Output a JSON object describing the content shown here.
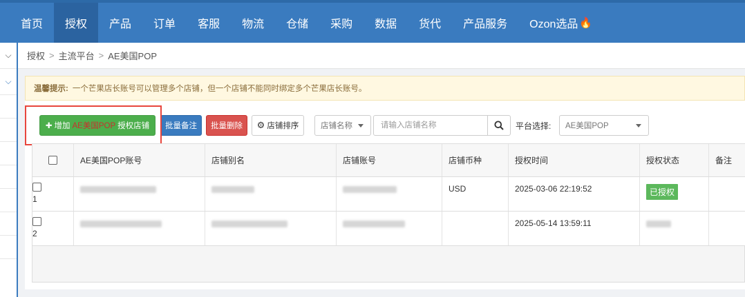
{
  "nav": {
    "items": [
      "首页",
      "授权",
      "产品",
      "订单",
      "客服",
      "物流",
      "仓储",
      "采购",
      "数据",
      "货代",
      "产品服务",
      "Ozon选品"
    ],
    "active": "授权"
  },
  "breadcrumb": [
    "授权",
    "主流平台",
    "AE美国POP"
  ],
  "tip": {
    "label": "温馨提示:",
    "text": "一个芒果店长账号可以管理多个店铺，但一个店铺不能同时绑定多个芒果店长账号。"
  },
  "toolbar": {
    "add_prefix": "增加",
    "add_platform": "AE美国POP",
    "add_suffix": "授权店铺",
    "batch_note": "批量备注",
    "batch_delete": "批量删除",
    "shop_sort": "店铺排序",
    "search_field_select": "店铺名称",
    "search_placeholder": "请输入店铺名称",
    "platform_label": "平台选择:",
    "platform_value": "AE美国POP"
  },
  "table": {
    "headers": [
      "AE美国POP账号",
      "店铺别名",
      "店铺账号",
      "店铺币种",
      "授权时间",
      "授权状态",
      "备注"
    ],
    "rows": [
      {
        "index": "1",
        "currency": "USD",
        "auth_time": "2025-03-06 22:19:52",
        "status": "已授权"
      },
      {
        "index": "2",
        "currency": "",
        "auth_time": "2025-05-14 13:59:11",
        "status": ""
      }
    ]
  },
  "colors": {
    "nav_bg": "#3a7bbf",
    "nav_active": "#2b63a0",
    "add_btn": "#4cae4c",
    "note_btn": "#3a7bbf",
    "delete_btn": "#d9534f",
    "authorized_badge": "#5cb85c",
    "highlight_outline": "#e8453c"
  },
  "icons": [
    "fire-icon",
    "plus-icon",
    "gear-icon",
    "search-icon",
    "chevron-down-icon",
    "caret-down-icon"
  ]
}
